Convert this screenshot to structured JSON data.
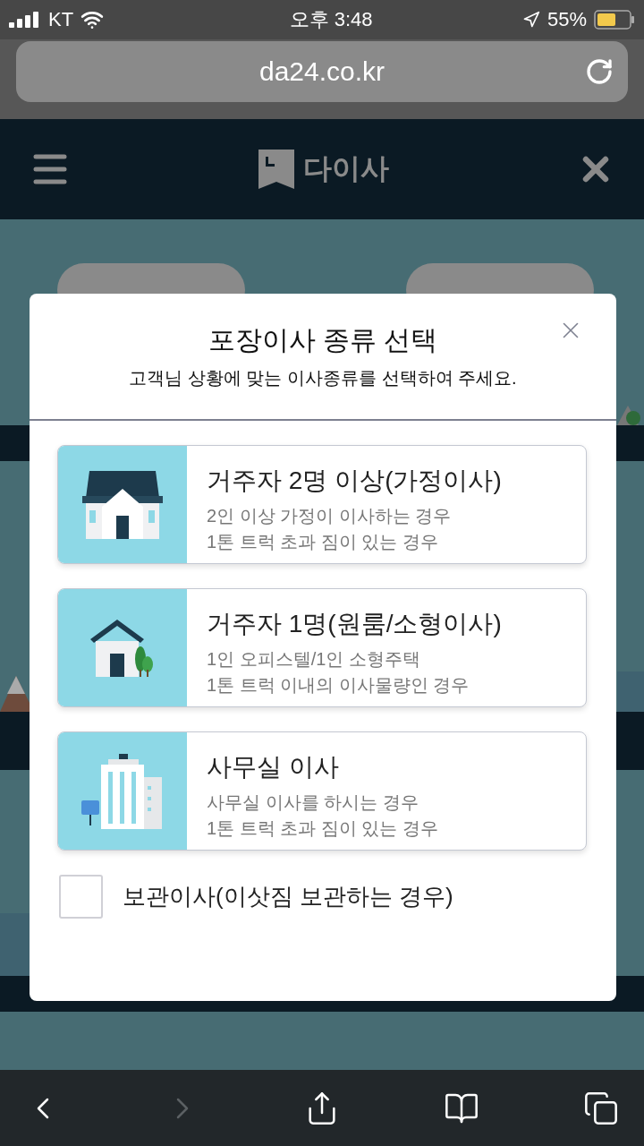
{
  "status_bar": {
    "carrier": "KT",
    "time": "오후 3:48",
    "battery": "55%"
  },
  "address_bar": {
    "url": "da24.co.kr"
  },
  "header": {
    "logo": "다이사"
  },
  "dialog": {
    "title": "포장이사 종류 선택",
    "subtitle": "고객님 상황에 맞는 이사종류를 선택하여 주세요.",
    "options": [
      {
        "kind": "family",
        "title": "거주자 2명 이상(가정이사)",
        "lines": [
          "2인 이상 가정이 이사하는 경우",
          "1톤 트럭 초과 짐이 있는 경우"
        ]
      },
      {
        "kind": "single",
        "title": "거주자 1명(원룸/소형이사)",
        "lines": [
          "1인 오피스텔/1인 소형주택",
          "1톤 트럭 이내의 이사물량인 경우"
        ]
      },
      {
        "kind": "office",
        "title": "사무실 이사",
        "lines": [
          "사무실 이사를 하시는 경우",
          "1톤 트럭 초과 짐이 있는 경우"
        ]
      }
    ],
    "storage": {
      "label": "보관이사(이삿짐 보관하는 경우)",
      "checked": false
    }
  },
  "toolbar": [
    {
      "kind": "back",
      "disabled": false
    },
    {
      "kind": "forward",
      "disabled": true
    },
    {
      "kind": "share",
      "disabled": false
    },
    {
      "kind": "bookmarks",
      "disabled": false
    },
    {
      "kind": "tabs",
      "disabled": false
    }
  ]
}
